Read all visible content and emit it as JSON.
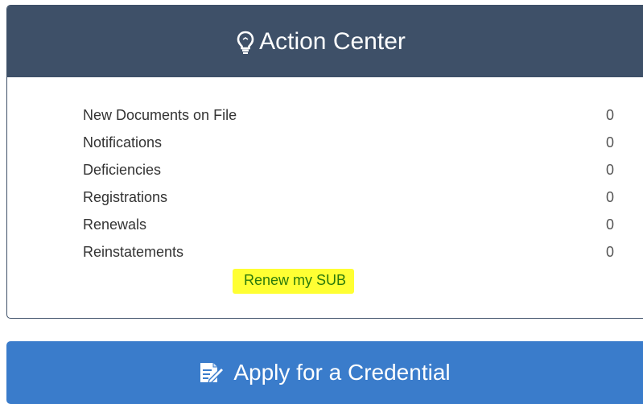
{
  "action_center": {
    "title": "Action Center",
    "icon": "lightbulb-icon",
    "items": [
      {
        "label": "New Documents on File",
        "count": "0"
      },
      {
        "label": "Notifications",
        "count": "0"
      },
      {
        "label": "Deficiencies",
        "count": "0"
      },
      {
        "label": "Registrations",
        "count": "0"
      },
      {
        "label": "Renewals",
        "count": "0"
      },
      {
        "label": "Reinstatements",
        "count": "0"
      }
    ],
    "renew_link": "Renew my SUB"
  },
  "apply_button": {
    "label": "Apply for a Credential",
    "icon": "edit-document-icon"
  },
  "colors": {
    "header_bg": "#3e5068",
    "button_bg": "#3a7ccb",
    "highlight": "#ffff33",
    "link": "#2b7a0b"
  }
}
